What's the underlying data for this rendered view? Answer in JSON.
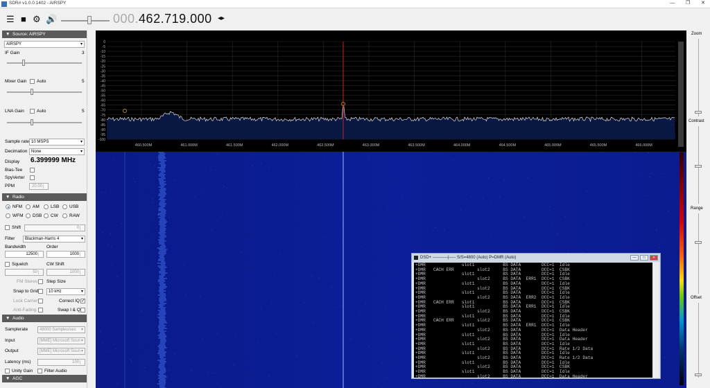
{
  "window": {
    "title": "SDR# v1.0.0.1402 - AIRSPY",
    "minimize": "—",
    "restore": "❐",
    "close": "✕"
  },
  "toolbar": {
    "freq_prefix": "000.",
    "freq_main": "462.719.000",
    "freq_arrows": "◂▸"
  },
  "source": {
    "header": "Source: AIRSPY",
    "device": "AIRSPY",
    "if_gain_label": "IF Gain",
    "if_gain_value": "3",
    "mixer_gain_label": "Mixer Gain",
    "mixer_auto": "Auto",
    "mixer_value": "5",
    "lna_gain_label": "LNA Gain",
    "lna_auto": "Auto",
    "lna_value": "5",
    "sample_rate_label": "Sample rate",
    "sample_rate": "10 MSPS",
    "decimation_label": "Decimation",
    "decimation": "None",
    "display_label": "Display",
    "display_value": "6.399999 MHz",
    "bias_tee": "Bias-Tee",
    "spyverter": "SpyVerter",
    "ppm_label": "PPM",
    "ppm_value": "20.00"
  },
  "radio": {
    "header": "Radio",
    "modes": [
      "NFM",
      "AM",
      "LSB",
      "USB",
      "WFM",
      "DSB",
      "CW",
      "RAW"
    ],
    "selected_mode": "NFM",
    "shift_label": "Shift",
    "shift_value": "0",
    "filter_label": "Filter",
    "filter": "Blackman-Harris 4",
    "bandwidth_label": "Bandwidth",
    "bandwidth": "12500",
    "order_label": "Order",
    "order": "1000",
    "squelch_label": "Squelch",
    "cw_shift_label": "CW Shift",
    "squelch_value": "50",
    "cw_shift_value": "1000",
    "fm_stereo": "FM Stereo",
    "step_size_label": "Step Size",
    "snap_label": "Snap to Grid",
    "step_size": "10 kHz",
    "lock_carrier": "Lock Carrier",
    "correct_iq": "Correct IQ",
    "anti_fading": "Anti-Fading",
    "swap_iq": "Swap I & Q"
  },
  "audio": {
    "header": "Audio",
    "samplerate_label": "Samplerate",
    "samplerate": "48000 Samples/sec",
    "input_label": "Input",
    "input": "[MME] Microsoft Soun",
    "output_label": "Output",
    "output": "[MME] Microsoft Soun",
    "latency_label": "Latency (ms)",
    "latency": "100",
    "unity_gain": "Unity Gain",
    "filter_audio": "Filter Audio"
  },
  "agc": {
    "header": "AGC"
  },
  "right_panel": {
    "zoom": "Zoom",
    "contrast": "Contrast",
    "range": "Range",
    "offset": "Offset"
  },
  "spectrum": {
    "y_ticks": [
      "0",
      "-5",
      "-10",
      "-15",
      "-20",
      "-25",
      "-30",
      "-35",
      "-40",
      "-45",
      "-50",
      "-55",
      "-60",
      "-65",
      "-70",
      "-75",
      "-80",
      "-85",
      "-90",
      "-95",
      "-100"
    ],
    "x_ticks": [
      "460.500M",
      "461.000M",
      "461.500M",
      "462.000M",
      "462.500M",
      "463.000M",
      "463.500M",
      "464.000M",
      "464.500M",
      "465.000M",
      "465.500M",
      "466.000M"
    ],
    "tuned_freq_mhz": 462.719
  },
  "dsd": {
    "title": "DSD+   -----------|-----  S/S=4800 (Auto) P=DMR (Auto)",
    "lines": [
      "+DMR              slot1           BS DATA        DCC=1  Idle",
      "+DMR   CACH ERR         slot2     BS DATA        DCC=1  CSBK",
      "+DMR              slot1           BS DATA        DCC=1  Idle",
      "+DMR                    slot2     BS DATA  ERR1  DCC=1  CSBK",
      "+DMR              slot1           BS DATA        DCC=1  Idle",
      "+DMR                    slot2     BS DATA        DCC=1  CSBK",
      "+DMR              slot1           BS DATA        DCC=1  Idle",
      "+DMR                    slot2     BS DATA  ERR2  DCC=1  Idle",
      "+DMR   CACH ERR   slot1           BS DATA        DCC=1  CSBK",
      "+DMR              slot1           BS DATA  ERR1  DCC=1  Idle",
      "+DMR                    slot2     BS DATA        DCC=1  CSBK",
      "+DMR              slot1           BS DATA        DCC=1  Idle",
      "+DMR   CACH ERR         slot2     BS DATA        DCC=1  CSBK",
      "+DMR              slot1           BS DATA  ERR1  DCC=1  Idle",
      "+DMR                    slot2     BS DATA        DCC=1  Data Header",
      "+DMR              slot1           BS DATA        DCC=1  Idle",
      "+DMR                    slot2     BS DATA        DCC=1  Data Header",
      "+DMR              slot1           BS DATA        DCC=1  Idle",
      "+DMR                    slot2     BS DATA        DCC=1  Rate 1/2 Data",
      "+DMR              slot1           BS DATA        DCC=1  Idle",
      "+DMR                    slot2     BS DATA        DCC=1  Rate 1/2 Data",
      "+DMR              slot1           BS DATA        DCC=1  Idle",
      "+DMR                    slot2     BS DATA        DCC=1  CSBK",
      "+DMR              slot1           BS DATA        DCC=1  Idle",
      "+DMR                    slot2     BS DATA        DCC=1  Data Header"
    ]
  }
}
